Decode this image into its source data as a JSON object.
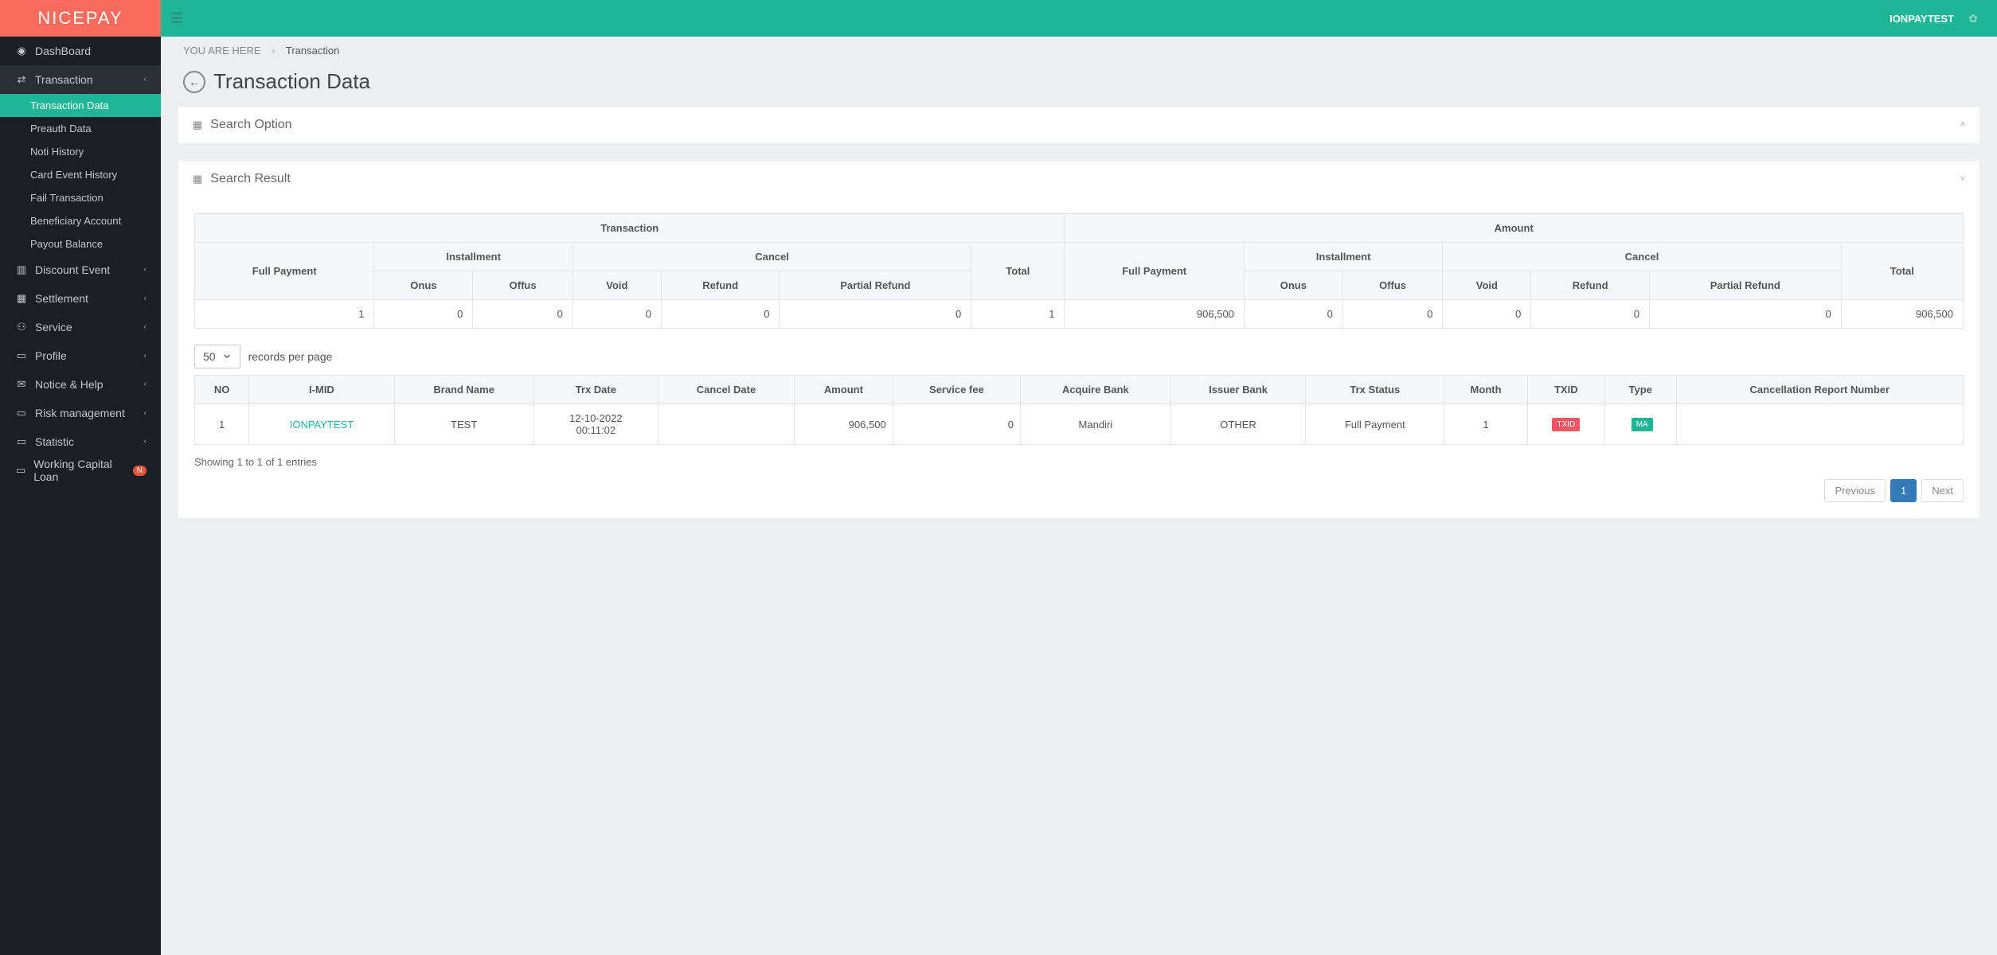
{
  "brand": "NICEPAY",
  "header": {
    "user": "IONPAYTEST"
  },
  "breadcrumb": {
    "label": "YOU ARE HERE",
    "current": "Transaction"
  },
  "page_title": "Transaction Data",
  "sidebar": {
    "dashboard": "DashBoard",
    "transaction": {
      "label": "Transaction",
      "items": [
        "Transaction Data",
        "Preauth Data",
        "Noti History",
        "Card Event History",
        "Fail Transaction",
        "Beneficiary Account",
        "Payout Balance"
      ]
    },
    "discount": "Discount Event",
    "settlement": "Settlement",
    "service": "Service",
    "profile": "Profile",
    "notice": "Notice & Help",
    "risk": "Risk management",
    "statistic": "Statistic",
    "capital": "Working Capital Loan",
    "capital_badge": "N"
  },
  "search_option": {
    "title": "Search Option"
  },
  "search_result": {
    "title": "Search Result"
  },
  "summary": {
    "headers": {
      "transaction": "Transaction",
      "amount": "Amount",
      "full_payment": "Full Payment",
      "installment": "Installment",
      "cancel": "Cancel",
      "onus": "Onus",
      "offus": "Offus",
      "void": "Void",
      "refund": "Refund",
      "partial_refund": "Partial Refund",
      "total": "Total"
    },
    "row": {
      "t_full": "1",
      "t_onus": "0",
      "t_offus": "0",
      "t_void": "0",
      "t_refund": "0",
      "t_partial": "0",
      "t_total": "1",
      "a_full": "906,500",
      "a_onus": "0",
      "a_offus": "0",
      "a_void": "0",
      "a_refund": "0",
      "a_partial": "0",
      "a_total": "906,500"
    }
  },
  "records": {
    "value": "50",
    "suffix": "records per page"
  },
  "table": {
    "headers": {
      "no": "NO",
      "imid": "I-MID",
      "brand": "Brand Name",
      "trx_date": "Trx Date",
      "cancel_date": "Cancel Date",
      "amount": "Amount",
      "service_fee": "Service fee",
      "acquire": "Acquire Bank",
      "issuer": "Issuer Bank",
      "status": "Trx Status",
      "month": "Month",
      "txid": "TXID",
      "type": "Type",
      "crn": "Cancellation Report Number"
    },
    "rows": [
      {
        "no": "1",
        "imid": "IONPAYTEST",
        "brand": "TEST",
        "trx_date_1": "12-10-2022",
        "trx_date_2": "00:11:02",
        "cancel_date": "",
        "amount": "906,500",
        "service_fee": "0",
        "acquire": "Mandiri",
        "issuer": "OTHER",
        "status": "Full Payment",
        "month": "1",
        "txid_tag": "TXID",
        "type_tag": "MA",
        "crn": ""
      }
    ]
  },
  "info": "Showing 1 to 1 of 1 entries",
  "pager": {
    "prev": "Previous",
    "page": "1",
    "next": "Next"
  }
}
